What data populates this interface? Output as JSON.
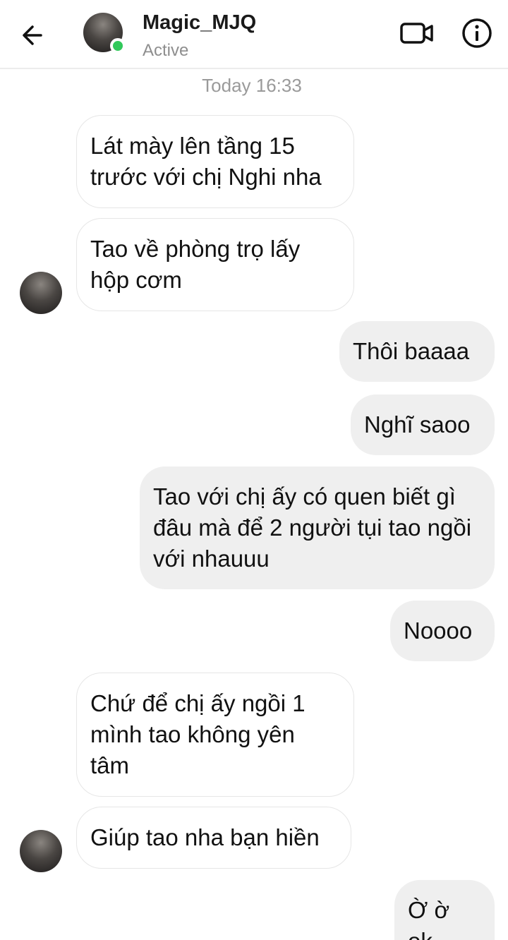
{
  "header": {
    "contact_name": "Magic_MJQ",
    "status": "Active",
    "icons": {
      "back": "arrow-left-icon",
      "video": "video-call-icon",
      "info": "info-icon"
    }
  },
  "timestamp": "Today 16:33",
  "colors": {
    "incoming_bubble": "#ffffff",
    "outgoing_bubble": "#efefef",
    "online_dot": "#31c85a",
    "muted_text": "#9a9a9a"
  },
  "messages": [
    {
      "direction": "incoming",
      "text": "Lát mày lên tầng 15 trước với chị Nghi nha"
    },
    {
      "direction": "incoming",
      "text": "Tao về phòng trọ lấy hộp cơm"
    },
    {
      "direction": "outgoing",
      "text": "Thôi baaaa"
    },
    {
      "direction": "outgoing",
      "text": "Nghĩ saoo"
    },
    {
      "direction": "outgoing",
      "text": "Tao với chị ấy có quen biết gì đâu mà để 2 người tụi tao ngồi với nhauuu"
    },
    {
      "direction": "outgoing",
      "text": "Noooo"
    },
    {
      "direction": "incoming",
      "text": "Chứ để chị ấy ngồi 1 mình tao không yên tâm"
    },
    {
      "direction": "incoming",
      "text": "Giúp tao nha bạn hiền"
    },
    {
      "direction": "outgoing",
      "text": "Ờ ờ ok"
    }
  ]
}
